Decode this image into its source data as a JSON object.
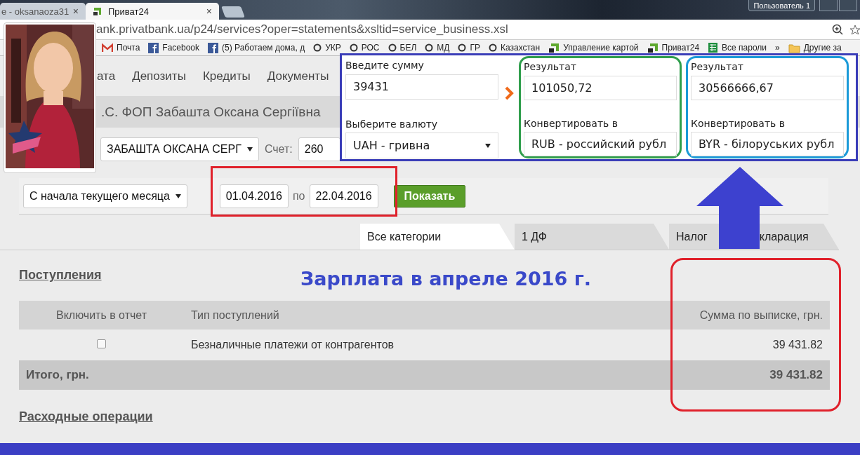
{
  "browser": {
    "tabs": [
      {
        "title": "e - oksanaoza31",
        "close": "×",
        "selected": false
      },
      {
        "title": "Приват24",
        "close": "×",
        "selected": true
      }
    ],
    "user_button": "Пользователь 1",
    "url": "ank.privatbank.ua/p24/services?oper=statements&xsltid=service_business.xsl",
    "bookmarks": [
      {
        "label": "Почта",
        "kind": "mail"
      },
      {
        "label": "Facebook",
        "kind": "facebook"
      },
      {
        "label": "(5) Работаем дома, д",
        "kind": "facebook"
      },
      {
        "label": "УКР",
        "kind": "ring"
      },
      {
        "label": "РОС",
        "kind": "ring"
      },
      {
        "label": "БЕЛ",
        "kind": "ring"
      },
      {
        "label": "МД",
        "kind": "ring"
      },
      {
        "label": "ГР",
        "kind": "ring"
      },
      {
        "label": "Казахстан",
        "kind": "ring"
      },
      {
        "label": "Управление картой",
        "kind": "privat"
      },
      {
        "label": "Приват24",
        "kind": "privat"
      },
      {
        "label": "Все пароли",
        "kind": "sheet"
      }
    ],
    "more": "»",
    "other_bookmarks": "Другие за"
  },
  "nav": [
    "ата",
    "Депозиты",
    "Кредиты",
    "Документы"
  ],
  "company": ".С. ФОП Забашта Оксана Сергіївна",
  "filters": {
    "client": "ЗАБАШТА ОКСАНА СЕРГ",
    "account_label": "Счет:",
    "account": "260",
    "period": "С начала текущего месяца",
    "date_from": "01.04.2016",
    "to_label": "по",
    "date_to": "22.04.2016",
    "show_button": "Показать"
  },
  "category_tabs": [
    {
      "label_parts": [
        "Все категории"
      ],
      "selected": true
    },
    {
      "label_parts": [
        "1 ДФ"
      ],
      "selected": false
    },
    {
      "label_parts": [
        "Налог",
        "кларация"
      ],
      "selected": false
    }
  ],
  "income": {
    "heading": "Поступления",
    "columns": [
      "Включить в отчет",
      "Тип поступлений",
      "Сумма по выписке, грн."
    ],
    "rows": [
      {
        "checked": false,
        "type": "Безналичные платежи от контрагентов",
        "amount": "39 431.82"
      }
    ],
    "total": {
      "label": "Итого, грн.",
      "amount": "39 431.82"
    }
  },
  "expenses_heading": "Расходные операции",
  "annotation": "Зарплата в апреле 2016 г.",
  "converter": {
    "amount_label": "Введите сумму",
    "amount": "39431",
    "currency_label": "Выберите валюту",
    "currency": "UAH - гривна",
    "results": [
      {
        "label": "Результат",
        "value": "101050,72",
        "convert_label": "Конвертировать в",
        "currency": "RUB - российский рубл",
        "color": "#2f9e4c"
      },
      {
        "label": "Результат",
        "value": "30566666,67",
        "convert_label": "Конвертировать в",
        "currency": "BYR - білоруських рубл",
        "color": "#1b9ad8"
      }
    ]
  }
}
